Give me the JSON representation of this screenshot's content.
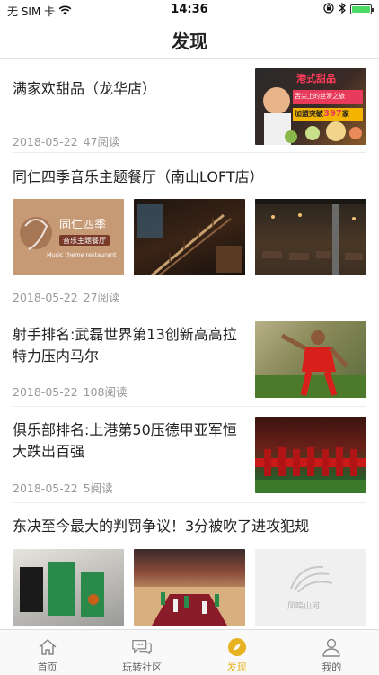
{
  "status_bar": {
    "carrier": "无 SIM 卡",
    "time": "14:36"
  },
  "nav": {
    "title": "发现"
  },
  "articles": [
    {
      "title": "满家欢甜品（龙华店）",
      "date": "2018-05-22",
      "reads": "47阅读",
      "images": [
        "promo-dessert-ad"
      ]
    },
    {
      "title": "同仁四季音乐主题餐厅（南山LOFT店）",
      "date": "2018-05-22",
      "reads": "27阅读",
      "images": [
        "restaurant-logo-sign",
        "restaurant-stairs",
        "restaurant-dining-hall"
      ]
    },
    {
      "title": "射手排名:武磊世界第13创新高高拉特力压内马尔",
      "date": "2018-05-22",
      "reads": "108阅读",
      "images": [
        "soccer-player-celebrating"
      ]
    },
    {
      "title": "俱乐部排名:上港第50压德甲亚军恒大跌出百强",
      "date": "2018-05-22",
      "reads": "5阅读",
      "images": [
        "soccer-team-lineup"
      ]
    },
    {
      "title": "东决至今最大的判罚争议！3分被吹了进攻犯规",
      "images": [
        "basketball-game-action",
        "basketball-court-overview",
        "placeholder-logo"
      ]
    }
  ],
  "ad_overlay": {
    "headline": "港式甜品",
    "sub": "舌尖上的丝滑之旅",
    "cta": "加盟突破",
    "count": "397",
    "unit": "家"
  },
  "logo_overlay": {
    "name": "同仁四季",
    "sub": "音乐主题餐厅",
    "en": "Music theme restaurant"
  },
  "placeholder_overlay": {
    "name": "凤鸣山河"
  },
  "tabs": [
    {
      "label": "首页",
      "icon": "home-icon",
      "active": false
    },
    {
      "label": "玩转社区",
      "icon": "chat-bubbles-icon",
      "active": false
    },
    {
      "label": "发现",
      "icon": "compass-icon",
      "active": true
    },
    {
      "label": "我的",
      "icon": "person-icon",
      "active": false
    }
  ],
  "colors": {
    "accent": "#e8b321",
    "divider": "#ececec",
    "meta_text": "#999999"
  }
}
